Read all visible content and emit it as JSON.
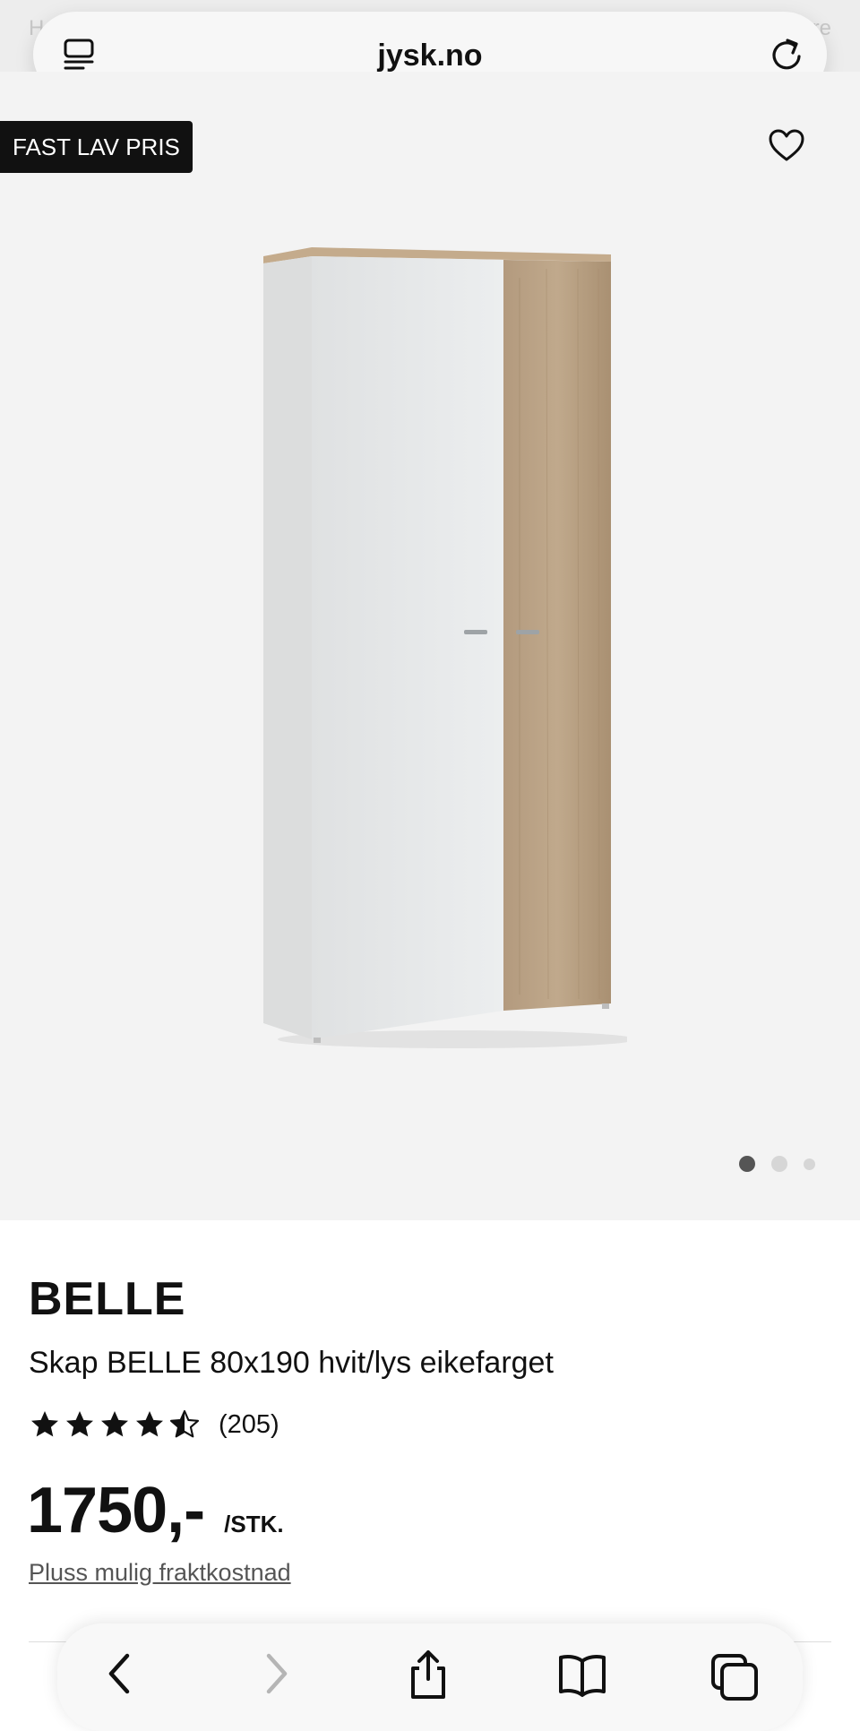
{
  "browser": {
    "url": "jysk.no",
    "behind_text_left": "H",
    "behind_text_right": "re"
  },
  "gallery": {
    "badge": "FAST LAV PRIS",
    "image_count": 3,
    "active_image": 1
  },
  "product": {
    "brand": "BELLE",
    "name": "Skap BELLE 80x190 hvit/lys eikefarget",
    "rating": 4.5,
    "review_count": "(205)",
    "price": "1750,-",
    "unit": "/STK.",
    "shipping_link": "Pluss mulig fraktkostnad"
  },
  "icons": {
    "reader": "reader-icon",
    "reload": "reload-icon",
    "favorite": "heart-icon",
    "back": "chevron-left-icon",
    "forward": "chevron-right-icon",
    "share": "share-icon",
    "bookmarks": "book-icon",
    "tabs": "tabs-icon"
  }
}
